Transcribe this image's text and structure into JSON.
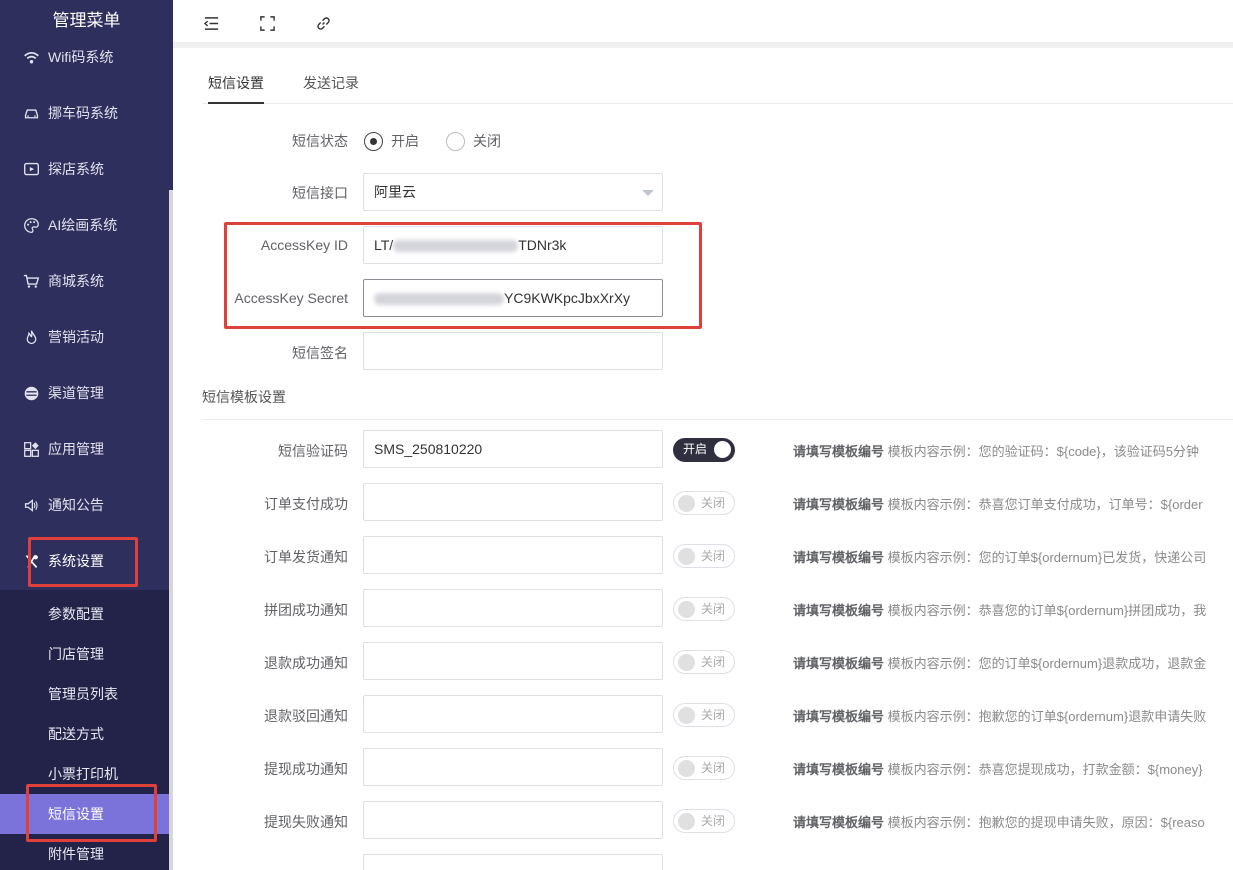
{
  "sidebar": {
    "title": "管理菜单",
    "items": [
      {
        "label": "Wifi码系统",
        "icon": "wifi-icon"
      },
      {
        "label": "挪车码系统",
        "icon": "car-icon"
      },
      {
        "label": "探店系统",
        "icon": "video-icon"
      },
      {
        "label": "AI绘画系统",
        "icon": "palette-icon"
      },
      {
        "label": "商城系统",
        "icon": "cart-icon"
      },
      {
        "label": "营销活动",
        "icon": "fire-icon"
      },
      {
        "label": "渠道管理",
        "icon": "channel-icon"
      },
      {
        "label": "应用管理",
        "icon": "apps-icon"
      },
      {
        "label": "通知公告",
        "icon": "speaker-icon"
      },
      {
        "label": "系统设置",
        "icon": "settings-icon"
      }
    ],
    "submenu": [
      "参数配置",
      "门店管理",
      "管理员列表",
      "配送方式",
      "小票打印机",
      "短信设置",
      "附件管理"
    ]
  },
  "topbar": {
    "icons": [
      "collapse-menu-icon",
      "fullscreen-icon",
      "link-icon"
    ]
  },
  "tabs": [
    "短信设置",
    "发送记录"
  ],
  "form": {
    "status_label": "短信状态",
    "status_on": "开启",
    "status_off": "关闭",
    "interface_label": "短信接口",
    "interface_value": "阿里云",
    "access_key_id_label": "AccessKey ID",
    "access_key_id_prefix": "LT/",
    "access_key_id_suffix": "TDNr3k",
    "access_key_secret_label": "AccessKey Secret",
    "access_key_secret_suffix": "YC9KWKpcJbxXrXy",
    "sign_label": "短信签名",
    "sign_value": ""
  },
  "template_section": {
    "title": "短信模板设置",
    "hint_prefix": "请填写模板编号",
    "rows": [
      {
        "label": "短信验证码",
        "value": "SMS_250810220",
        "switch": "开启",
        "on": true,
        "example": "模板内容示例：您的验证码：${code}，该验证码5分钟"
      },
      {
        "label": "订单支付成功",
        "value": "",
        "switch": "关闭",
        "on": false,
        "example": "模板内容示例：恭喜您订单支付成功，订单号：${order"
      },
      {
        "label": "订单发货通知",
        "value": "",
        "switch": "关闭",
        "on": false,
        "example": "模板内容示例：您的订单${ordernum}已发货，快递公司"
      },
      {
        "label": "拼团成功通知",
        "value": "",
        "switch": "关闭",
        "on": false,
        "example": "模板内容示例：恭喜您的订单${ordernum}拼团成功，我"
      },
      {
        "label": "退款成功通知",
        "value": "",
        "switch": "关闭",
        "on": false,
        "example": "模板内容示例：您的订单${ordernum}退款成功，退款金"
      },
      {
        "label": "退款驳回通知",
        "value": "",
        "switch": "关闭",
        "on": false,
        "example": "模板内容示例：抱歉您的订单${ordernum}退款申请失败"
      },
      {
        "label": "提现成功通知",
        "value": "",
        "switch": "关闭",
        "on": false,
        "example": "模板内容示例：恭喜您提现成功，打款金额：${money}"
      },
      {
        "label": "提现失败通知",
        "value": "",
        "switch": "关闭",
        "on": false,
        "example": "模板内容示例：抱歉您的提现申请失败，原因：${reaso"
      }
    ]
  },
  "colors": {
    "sidebar_bg": "#2f2f5e",
    "submenu_active": "#7b73d9",
    "highlight": "#e0403a"
  }
}
